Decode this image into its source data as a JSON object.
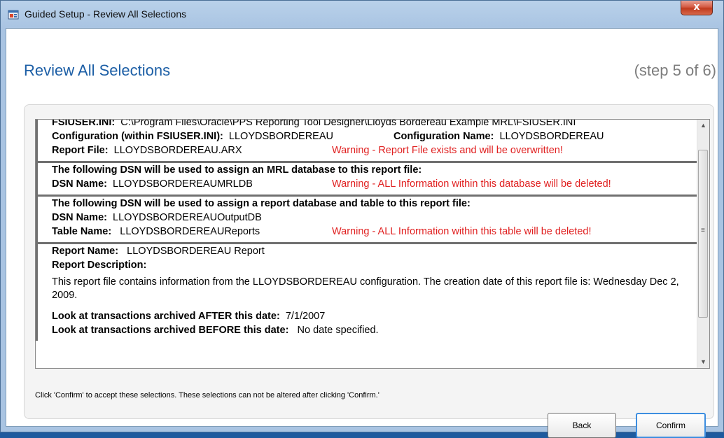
{
  "window": {
    "title": "Guided Setup - Review All Selections",
    "close_glyph": "x",
    "icon": "app-setup-icon"
  },
  "header": {
    "title": "Review All Selections",
    "step": "(step 5 of 6)"
  },
  "review": {
    "fsiuser_label": "FSIUSER.INI:",
    "fsiuser_value": "C:\\Program Files\\Oracle\\PPS Reporting Tool Designer\\Lloyds Bordereau Example MRL\\FSIUSER.INI",
    "config_label": "Configuration (within FSIUSER.INI):",
    "config_value": "LLOYDSBORDEREAU",
    "config_name_label": "Configuration Name:",
    "config_name_value": "LLOYDSBORDEREAU",
    "report_file_label": "Report File:",
    "report_file_value": "LLOYDSBORDEREAU.ARX",
    "report_file_warning": "Warning - Report File exists and will be overwritten!",
    "mrl_heading": "The following DSN will be used to assign an MRL database to this report file:",
    "mrl_dsn_label": "DSN Name:",
    "mrl_dsn_value": "LLOYDSBORDEREAUMRLDB",
    "mrl_warning": "Warning - ALL Information within this database will be deleted!",
    "rep_heading": "The following DSN will be used to assign a report database and table to this report file:",
    "rep_dsn_label": "DSN Name:",
    "rep_dsn_value": "LLOYDSBORDEREAUOutputDB",
    "table_label": "Table Name:",
    "table_value": "LLOYDSBORDEREAUReports",
    "table_warning": "Warning - ALL Information within this table will be deleted!",
    "report_name_label": "Report Name:",
    "report_name_value": "LLOYDSBORDEREAU Report",
    "report_desc_label": "Report Description:",
    "report_desc_value": "This report file contains information from the LLOYDSBORDEREAU configuration.  The creation date of this report file is: Wednesday Dec 2, 2009.",
    "after_label": "Look at transactions archived AFTER this date:",
    "after_value": "7/1/2007",
    "before_label": "Look at transactions archived BEFORE this date:",
    "before_value": "No date specified."
  },
  "scrollbar": {
    "up": "▲",
    "down": "▼",
    "grip": "≡"
  },
  "footer": {
    "note": "Click 'Confirm' to accept these selections.  These selections can not be altered after clicking 'Confirm.'",
    "back_label": "Back",
    "confirm_label": "Confirm"
  },
  "colors": {
    "heading": "#1d5fa6",
    "warning": "#e02020",
    "step": "#7d7d7d"
  }
}
